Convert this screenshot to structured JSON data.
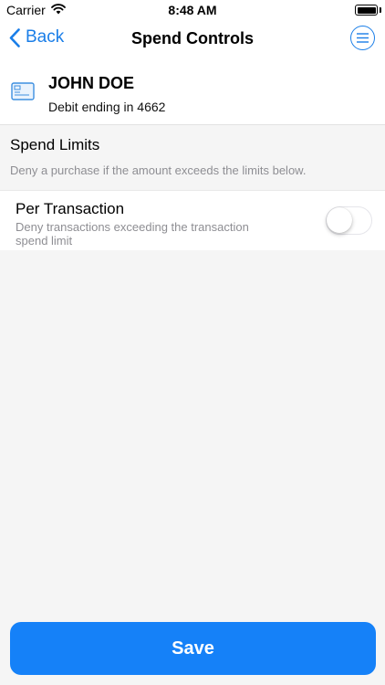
{
  "status_bar": {
    "carrier": "Carrier",
    "time": "8:48 AM",
    "icons": [
      "wifi-icon",
      "battery-icon"
    ]
  },
  "nav": {
    "back_label": "Back",
    "title": "Spend Controls",
    "accent_color": "#1a7ee8",
    "icons": [
      "chevron-left-icon",
      "menu-icon"
    ]
  },
  "card": {
    "holder_name": "JOHN DOE",
    "subtitle": "Debit ending in 4662",
    "icon": "credit-card-icon"
  },
  "spend_limits": {
    "title": "Spend Limits",
    "description": "Deny a purchase if the amount exceeds the limits below."
  },
  "per_transaction": {
    "title": "Per Transaction",
    "description": "Deny transactions exceeding the transaction spend limit",
    "enabled": false
  },
  "save": {
    "label": "Save",
    "color": "#1581f8"
  }
}
